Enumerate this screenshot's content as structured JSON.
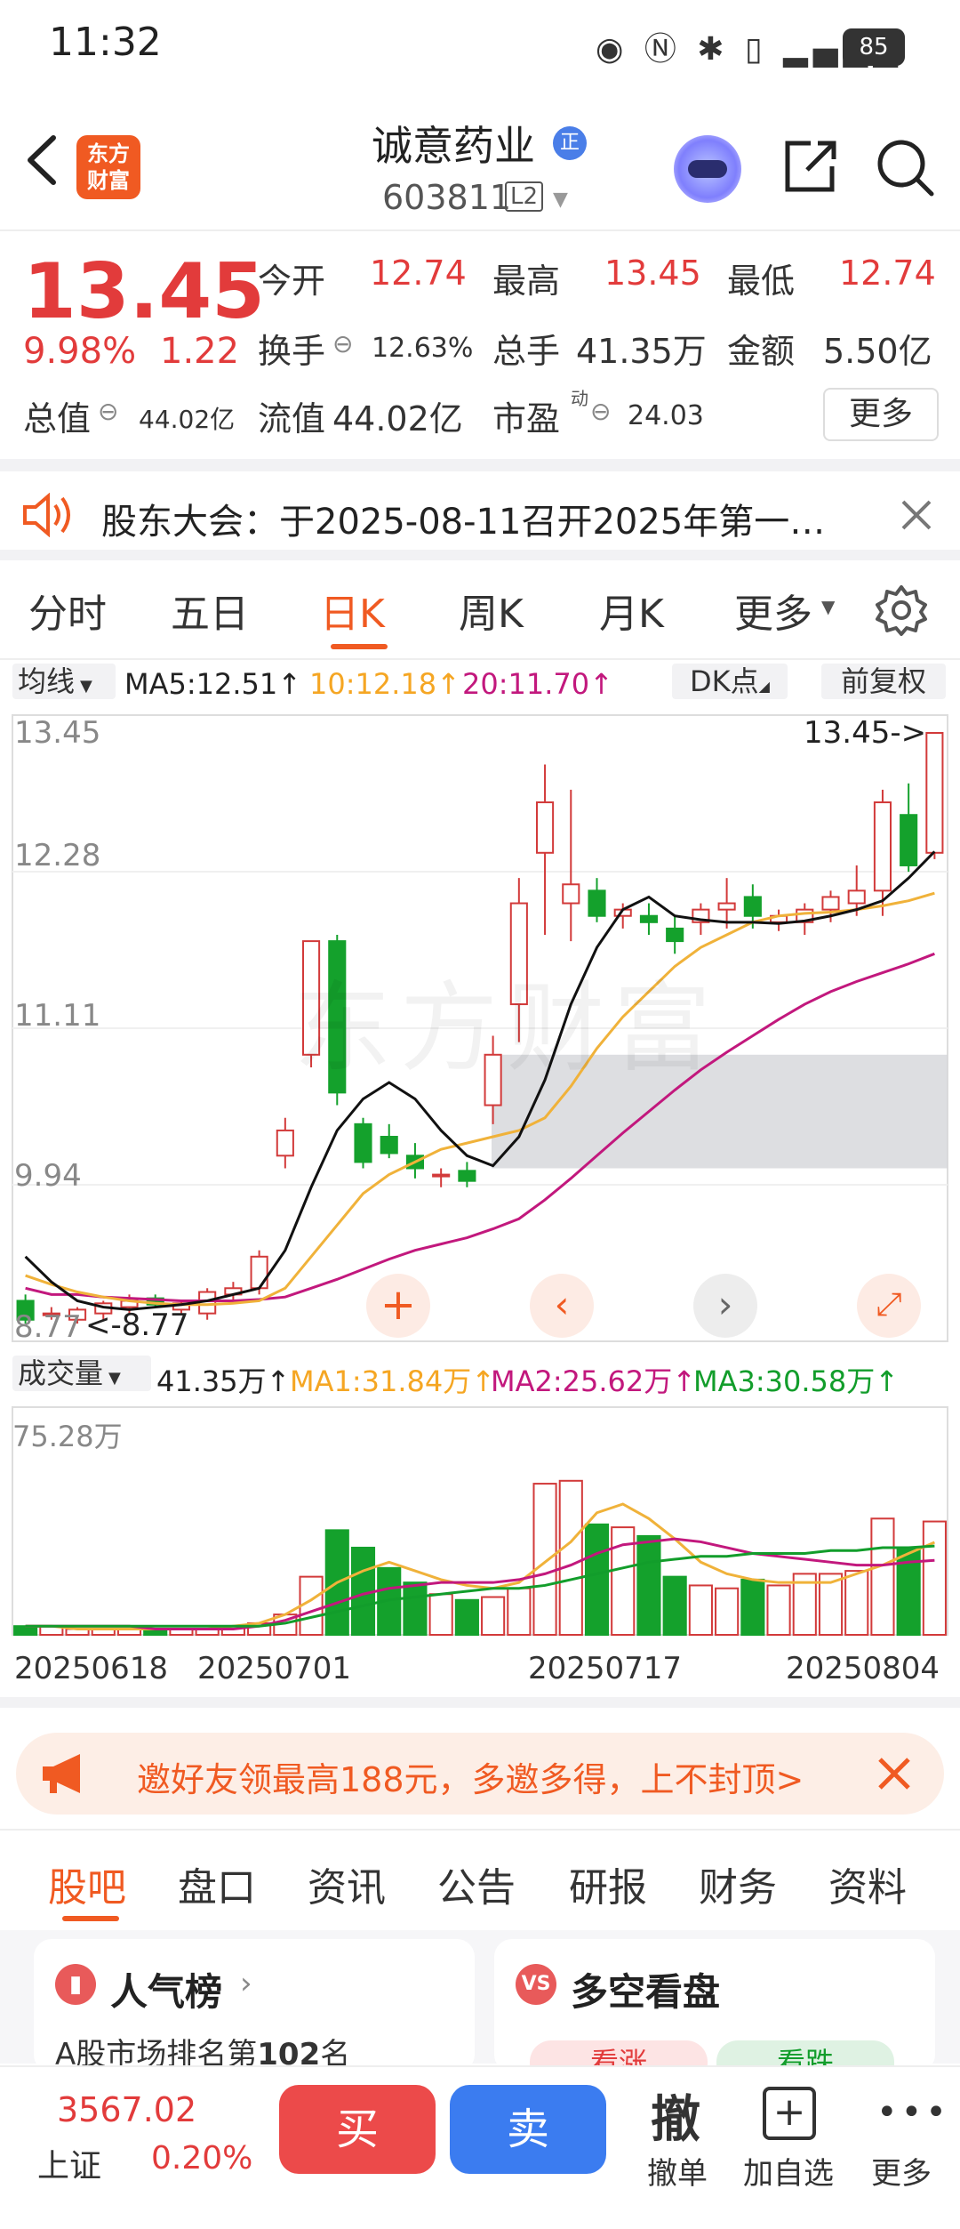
{
  "status_bar": {
    "time": "11:32",
    "battery": "85"
  },
  "header": {
    "title": "诚意药业",
    "badge": "正",
    "code": "603811",
    "level": "L2",
    "logo_line1": "东方",
    "logo_line2": "财富"
  },
  "quote": {
    "price": "13.45",
    "change_pct": "9.98%",
    "change": "1.22",
    "open_label": "今开",
    "open": "12.74",
    "high_label": "最高",
    "high": "13.45",
    "low_label": "最低",
    "low": "12.74",
    "turnover_label": "换手",
    "turnover": "12.63%",
    "volume_label": "总手",
    "volume": "41.35万",
    "amount_label": "金额",
    "amount": "5.50亿",
    "mktcap_label": "总值",
    "mktcap": "44.02亿",
    "float_label": "流值",
    "float": "44.02亿",
    "pe_label": "市盈",
    "pe_sup": "动",
    "pe": "24.03",
    "more": "更多"
  },
  "notice": {
    "text": "股东大会：于2025-08-11召开2025年第一…"
  },
  "chart_tabs": [
    "分时",
    "五日",
    "日K",
    "周K",
    "月K",
    "更多"
  ],
  "active_chart_tab": "日K",
  "ma_bar": {
    "selector": "均线",
    "ma5": "MA5:12.51↑",
    "ma10": "10:12.18↑",
    "ma20": "20:11.70↑",
    "dk": "DK点",
    "adjust": "前复权"
  },
  "kline": {
    "y_labels": [
      "13.45",
      "12.28",
      "11.11",
      "9.94",
      "8.77"
    ],
    "last_price_tag": "13.45->",
    "low_tag": "<-8.77",
    "watermark": "东方财富"
  },
  "volume_bar": {
    "selector": "成交量",
    "vol": "41.35万↑",
    "ma1": "MA1:31.84万↑",
    "ma2": "MA2:25.62万↑",
    "ma3": "MA3:30.58万↑",
    "max_label": "75.28万"
  },
  "dates": [
    "20250618",
    "20250701",
    "20250717",
    "20250804"
  ],
  "promo": {
    "text": "邀好友领最高188元，多邀多得，上不封顶>"
  },
  "bottom_tabs": [
    "股吧",
    "盘口",
    "资讯",
    "公告",
    "研报",
    "财务",
    "资料"
  ],
  "cards": {
    "left_title": "人气榜",
    "left_sub_prefix": "A股市场排名第",
    "left_rank": "102",
    "left_sub_suffix": "名",
    "right_title": "多空看盘",
    "right_up": "看涨",
    "right_down": "看跌"
  },
  "index": {
    "value": "3567.02",
    "name": "上证",
    "pct": "0.20%"
  },
  "actions": {
    "buy": "买",
    "sell": "卖",
    "cancel": "撤",
    "cancel_label": "撤单",
    "add_label": "加自选",
    "more_label": "更多"
  },
  "chart_data": {
    "type": "candlestick",
    "candles": [
      {
        "o": 8.95,
        "h": 9.0,
        "l": 8.77,
        "c": 8.8
      },
      {
        "o": 8.85,
        "h": 8.9,
        "l": 8.8,
        "c": 8.85
      },
      {
        "o": 8.8,
        "h": 8.9,
        "l": 8.77,
        "c": 8.88
      },
      {
        "o": 8.85,
        "h": 8.95,
        "l": 8.8,
        "c": 8.93
      },
      {
        "o": 8.9,
        "h": 9.0,
        "l": 8.85,
        "c": 8.95
      },
      {
        "o": 8.97,
        "h": 9.0,
        "l": 8.9,
        "c": 8.92
      },
      {
        "o": 8.88,
        "h": 8.95,
        "l": 8.85,
        "c": 8.93
      },
      {
        "o": 8.85,
        "h": 9.05,
        "l": 8.8,
        "c": 9.02
      },
      {
        "o": 9.0,
        "h": 9.1,
        "l": 8.95,
        "c": 9.05
      },
      {
        "o": 9.05,
        "h": 9.35,
        "l": 9.0,
        "c": 9.3
      },
      {
        "o": 10.1,
        "h": 10.4,
        "l": 10.0,
        "c": 10.3
      },
      {
        "o": 10.9,
        "h": 11.8,
        "l": 10.8,
        "c": 11.8
      },
      {
        "o": 11.8,
        "h": 11.85,
        "l": 10.5,
        "c": 10.6
      },
      {
        "o": 10.35,
        "h": 10.4,
        "l": 10.0,
        "c": 10.05
      },
      {
        "o": 10.25,
        "h": 10.35,
        "l": 10.08,
        "c": 10.12
      },
      {
        "o": 10.1,
        "h": 10.2,
        "l": 9.92,
        "c": 10.0
      },
      {
        "o": 9.95,
        "h": 10.0,
        "l": 9.85,
        "c": 9.95
      },
      {
        "o": 9.98,
        "h": 10.05,
        "l": 9.85,
        "c": 9.9
      },
      {
        "o": 10.5,
        "h": 11.05,
        "l": 10.35,
        "c": 10.9
      },
      {
        "o": 11.3,
        "h": 12.3,
        "l": 11.0,
        "c": 12.1
      },
      {
        "o": 12.5,
        "h": 13.2,
        "l": 11.85,
        "c": 12.9
      },
      {
        "o": 12.1,
        "h": 13.0,
        "l": 11.8,
        "c": 12.25
      },
      {
        "o": 12.2,
        "h": 12.3,
        "l": 11.95,
        "c": 12.0
      },
      {
        "o": 12.0,
        "h": 12.1,
        "l": 11.9,
        "c": 12.05
      },
      {
        "o": 12.0,
        "h": 12.1,
        "l": 11.85,
        "c": 11.95
      },
      {
        "o": 11.9,
        "h": 12.0,
        "l": 11.7,
        "c": 11.8
      },
      {
        "o": 11.95,
        "h": 12.1,
        "l": 11.85,
        "c": 12.05
      },
      {
        "o": 12.05,
        "h": 12.3,
        "l": 11.9,
        "c": 12.1
      },
      {
        "o": 12.15,
        "h": 12.25,
        "l": 11.9,
        "c": 12.0
      },
      {
        "o": 11.95,
        "h": 12.05,
        "l": 11.88,
        "c": 12.0
      },
      {
        "o": 11.95,
        "h": 12.1,
        "l": 11.85,
        "c": 12.05
      },
      {
        "o": 12.05,
        "h": 12.2,
        "l": 11.95,
        "c": 12.15
      },
      {
        "o": 12.1,
        "h": 12.4,
        "l": 12.0,
        "c": 12.2
      },
      {
        "o": 12.2,
        "h": 13.0,
        "l": 12.0,
        "c": 12.9
      },
      {
        "o": 12.8,
        "h": 13.05,
        "l": 12.35,
        "c": 12.4
      },
      {
        "o": 12.5,
        "h": 13.45,
        "l": 12.45,
        "c": 13.45
      }
    ],
    "ma5": [
      9.3,
      9.1,
      8.95,
      8.9,
      8.88,
      8.9,
      8.92,
      8.95,
      9.0,
      9.05,
      9.35,
      9.85,
      10.3,
      10.55,
      10.68,
      10.55,
      10.3,
      10.1,
      10.02,
      10.25,
      10.7,
      11.3,
      11.75,
      12.05,
      12.15,
      12.0,
      11.97,
      11.95,
      11.95,
      11.94,
      11.96,
      12.0,
      12.05,
      12.12,
      12.3,
      12.51
    ],
    "ma10": [
      9.15,
      9.08,
      9.02,
      8.98,
      8.95,
      8.93,
      8.92,
      8.92,
      8.93,
      8.95,
      9.05,
      9.3,
      9.55,
      9.8,
      9.95,
      10.05,
      10.15,
      10.2,
      10.25,
      10.3,
      10.4,
      10.65,
      10.95,
      11.2,
      11.4,
      11.6,
      11.75,
      11.85,
      11.95,
      12.0,
      12.02,
      12.03,
      12.05,
      12.08,
      12.12,
      12.18
    ],
    "ma20": [
      9.05,
      9.0,
      9.0,
      8.98,
      8.97,
      8.96,
      8.95,
      8.95,
      8.95,
      8.96,
      8.98,
      9.05,
      9.12,
      9.2,
      9.28,
      9.35,
      9.4,
      9.45,
      9.52,
      9.6,
      9.75,
      9.92,
      10.1,
      10.28,
      10.45,
      10.62,
      10.78,
      10.92,
      11.05,
      11.18,
      11.3,
      11.4,
      11.48,
      11.55,
      11.62,
      11.7
    ],
    "volumes": [
      3,
      3,
      2,
      2,
      2,
      2,
      2,
      2,
      3,
      4,
      7,
      20,
      36,
      30,
      23,
      18,
      14,
      12,
      13,
      16,
      52,
      53,
      38,
      37,
      34,
      20,
      17,
      16,
      19,
      17,
      21,
      21,
      22,
      40,
      30,
      39
    ],
    "vol_ma1": [
      3,
      3,
      2,
      2,
      2,
      2,
      2,
      2,
      3,
      4,
      7,
      12,
      18,
      22,
      25,
      22,
      19,
      17,
      16,
      18,
      25,
      32,
      42,
      45,
      40,
      33,
      25,
      21,
      19,
      18,
      18,
      18,
      21,
      24,
      28,
      31.84
    ],
    "vol_ma2": [
      3,
      3,
      3,
      3,
      3,
      2,
      2,
      2,
      2,
      3,
      5,
      8,
      11,
      14,
      16,
      17,
      18,
      18,
      18,
      19,
      21,
      24,
      28,
      31,
      32,
      33,
      32,
      30,
      28,
      27,
      26,
      25,
      24,
      24,
      25,
      25.62
    ],
    "vol_ma3": [
      3,
      3,
      3,
      3,
      3,
      3,
      3,
      3,
      3,
      3,
      4,
      6,
      8,
      10,
      12,
      13,
      14,
      15,
      16,
      16,
      17,
      19,
      21,
      23,
      25,
      26,
      27,
      27,
      28,
      28,
      28,
      29,
      29,
      30,
      30,
      30.58
    ],
    "ylim": [
      8.77,
      13.45
    ],
    "vol_max": 75.28
  }
}
